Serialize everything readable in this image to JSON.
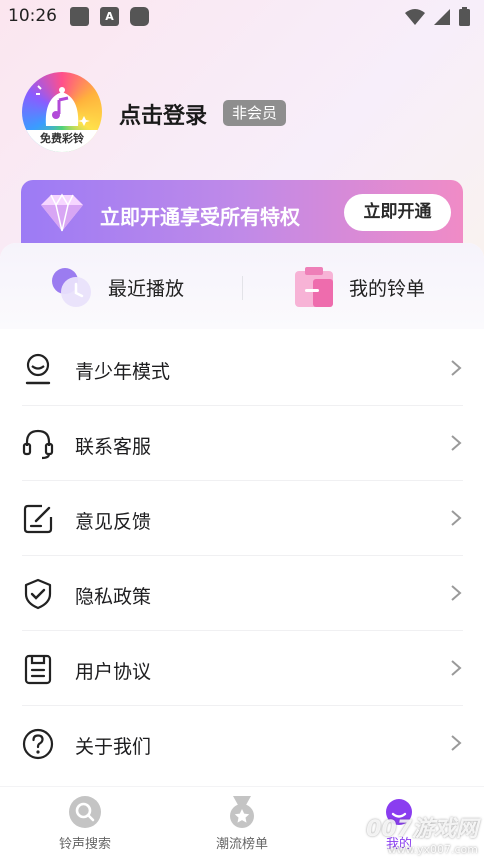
{
  "status_bar": {
    "time": "10:26",
    "notif_icon_letter": "A"
  },
  "profile": {
    "login_text": "点击登录",
    "member_badge": "非会员",
    "avatar_caption": "免费彩铃"
  },
  "vip": {
    "text": "立即开通享受所有特权",
    "button": "立即开通"
  },
  "quick": [
    {
      "label": "最近播放"
    },
    {
      "label": "我的铃单"
    }
  ],
  "menu": [
    {
      "label": "青少年模式",
      "icon": "teen-mode-icon"
    },
    {
      "label": "联系客服",
      "icon": "headset-icon"
    },
    {
      "label": "意见反馈",
      "icon": "feedback-icon"
    },
    {
      "label": "隐私政策",
      "icon": "shield-icon"
    },
    {
      "label": "用户协议",
      "icon": "agreement-icon"
    },
    {
      "label": "关于我们",
      "icon": "help-icon"
    }
  ],
  "nav": [
    {
      "label": "铃声搜索",
      "icon": "search-icon",
      "active": false
    },
    {
      "label": "潮流榜单",
      "icon": "ranking-medal-icon",
      "active": false
    },
    {
      "label": "我的",
      "icon": "profile-icon",
      "active": true
    }
  ],
  "watermark": {
    "main": "007游戏网",
    "sub": "www.yx007.com"
  },
  "colors": {
    "accent": "#8a3df0",
    "vip_start": "#9c7bf5",
    "vip_end": "#f08bc6",
    "badge": "#8e8e8e"
  }
}
